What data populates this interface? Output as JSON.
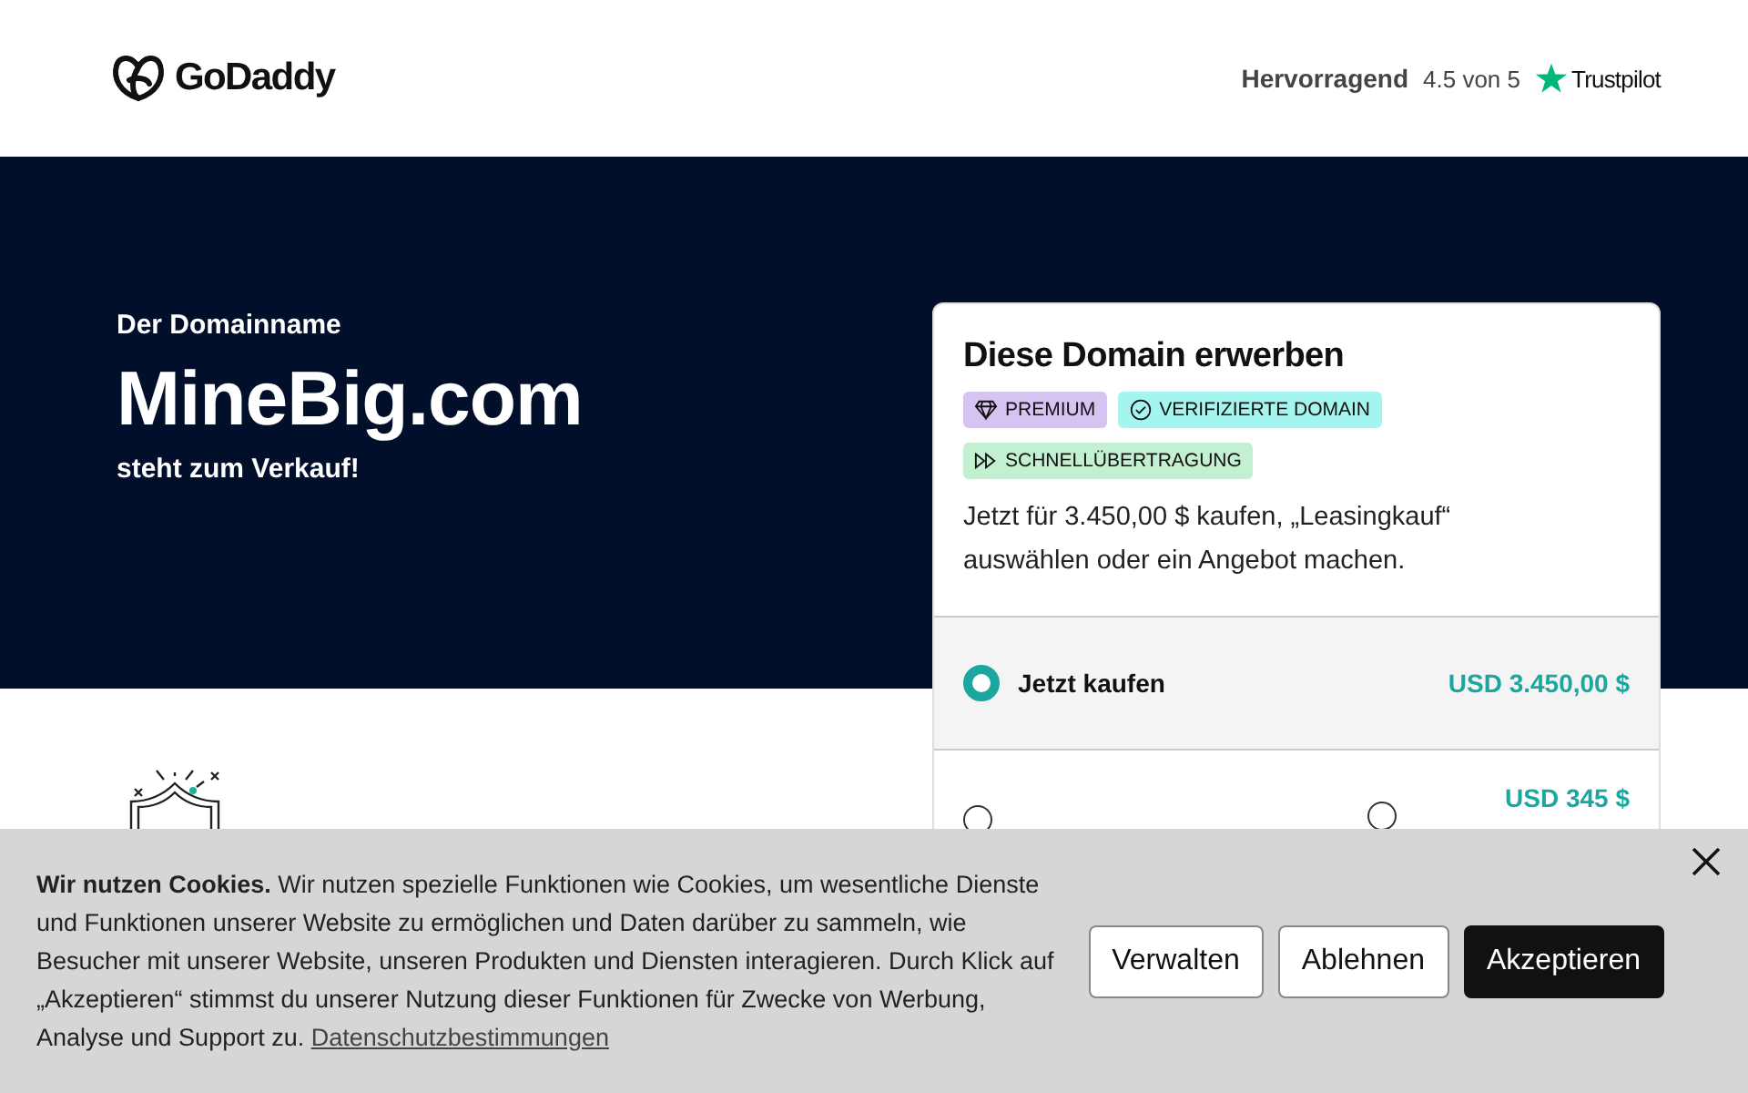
{
  "header": {
    "logo": "GoDaddy",
    "rating_label": "Hervorragend",
    "rating_score": "4.5 von 5",
    "rating_brand": "Trustpilot"
  },
  "hero": {
    "eyebrow": "Der Domainname",
    "domain": "MineBig.com",
    "subtitle": "steht zum Verkauf!"
  },
  "purchase_card": {
    "title": "Diese Domain erwerben",
    "badges": [
      {
        "kind": "premium",
        "label": "PREMIUM"
      },
      {
        "kind": "verified",
        "label": "VERIFIZIERTE DOMAIN"
      },
      {
        "kind": "fast",
        "label": "SCHNELLÜBERTRAGUNG"
      }
    ],
    "description": "Jetzt für 3.450,00 $ kaufen, „Leasingkauf“ auswählen oder ein Angebot machen.",
    "options": [
      {
        "label": "Jetzt kaufen",
        "price": "USD 3.450,00 $",
        "selected": true
      },
      {
        "price": "USD 345 $",
        "selected": false
      }
    ]
  },
  "cookie_banner": {
    "text": "**Wir nutzen Cookies.** Wir nutzen spezielle Funktionen wie Cookies, um wesentliche Dienste und Funktionen unserer Website zu ermöglichen und Daten darüber zu sammeln, wie Besucher mit unserer Website, unseren Produkten und Diensten interagieren. Durch Klick auf „Akzeptieren“ stimmst du unserer Nutzung dieser Funktionen für Zwecke von Werbung, Analyse und Support zu.",
    "link": "Datenschutzbestimmungen",
    "buttons": [
      {
        "kind": "secondary",
        "label": "Verwalten"
      },
      {
        "kind": "secondary",
        "label": "Ablehnen"
      },
      {
        "kind": "primary",
        "label": "Akzeptieren"
      }
    ]
  }
}
